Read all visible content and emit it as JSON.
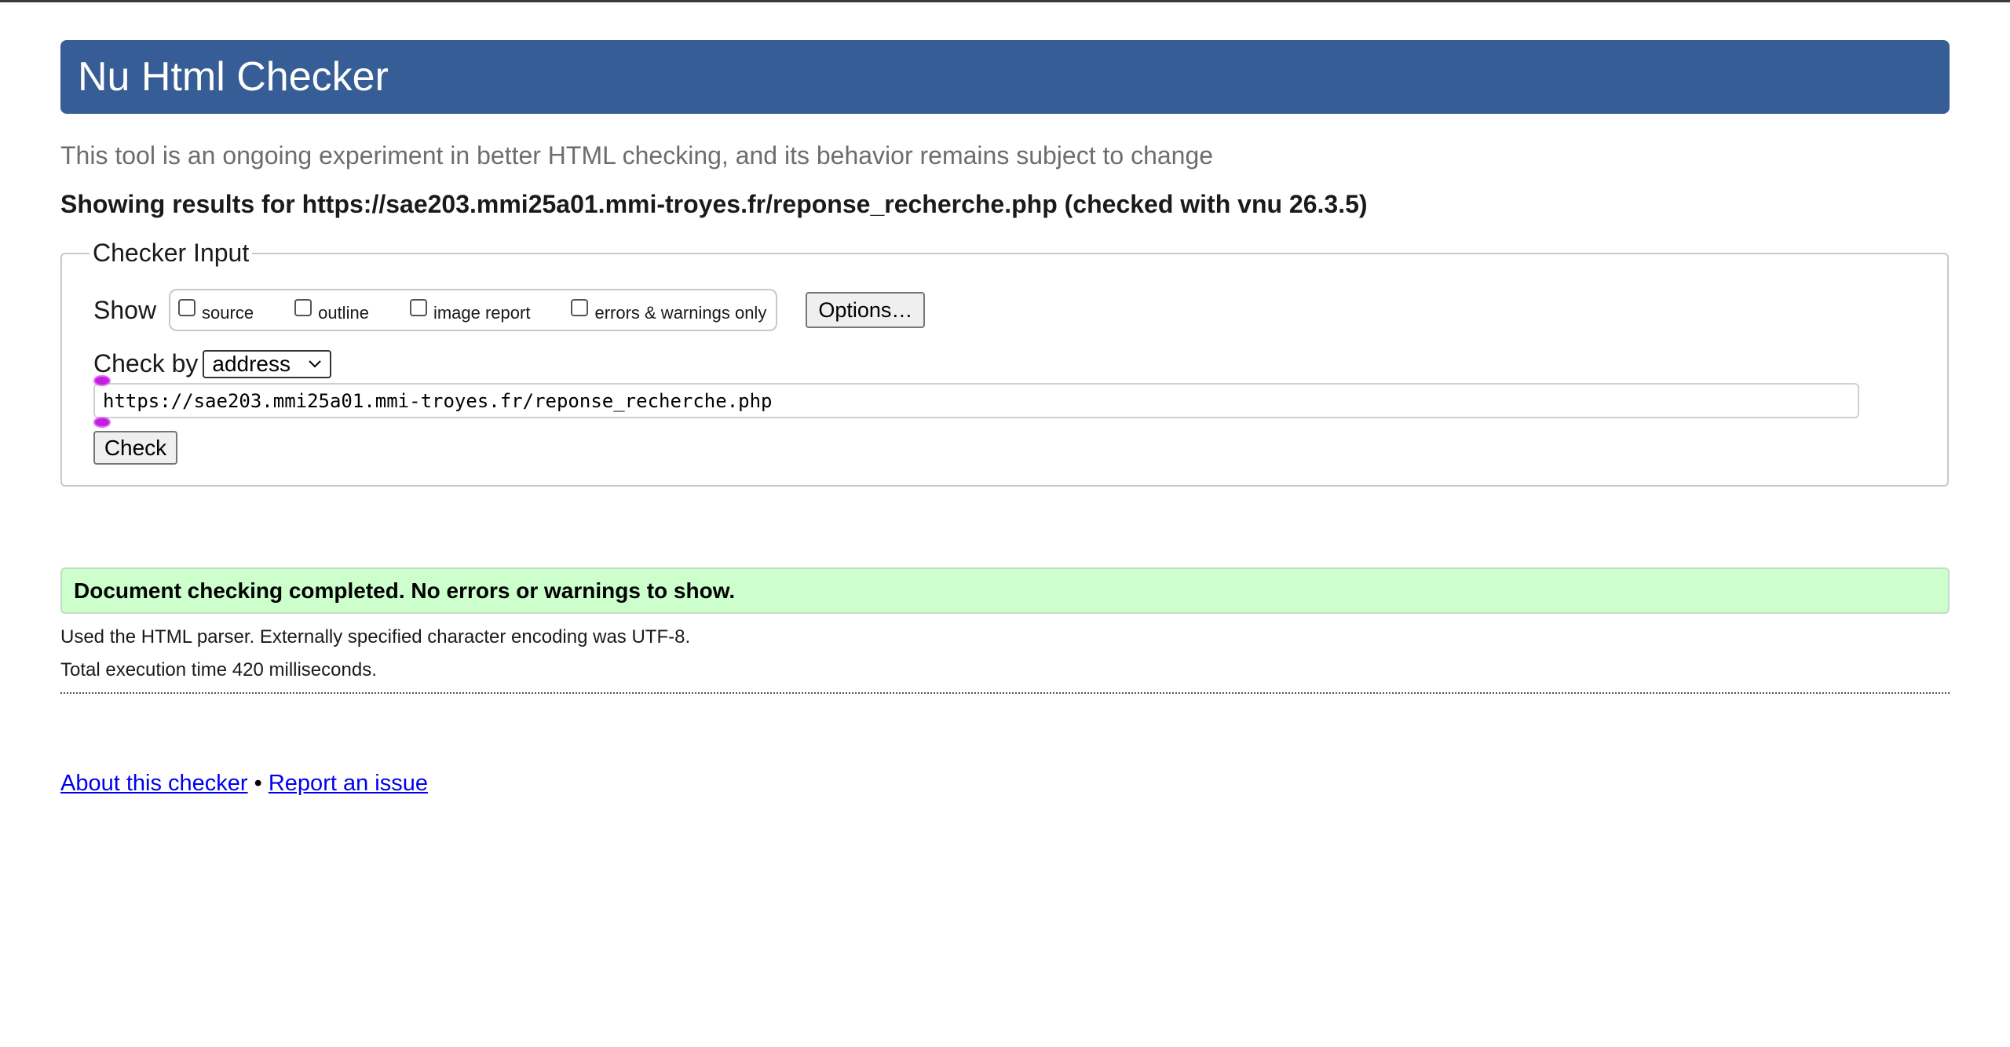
{
  "header": {
    "title": "Nu Html Checker"
  },
  "tagline": "This tool is an ongoing experiment in better HTML checking, and its behavior remains subject to change",
  "results_for": "Showing results for https://sae203.mmi25a01.mmi-troyes.fr/reponse_recherche.php (checked with vnu 26.3.5)",
  "checker_input": {
    "legend": "Checker Input",
    "show_label": "Show",
    "options": [
      {
        "label": "source",
        "checked": false
      },
      {
        "label": "outline",
        "checked": false
      },
      {
        "label": "image report",
        "checked": false
      },
      {
        "label": "errors & warnings only",
        "checked": false
      }
    ],
    "options_button": "Options…",
    "check_by_label": "Check by",
    "check_by_value": "address",
    "url_value": "https://sae203.mmi25a01.mmi-troyes.fr/reponse_recherche.php",
    "check_button": "Check"
  },
  "result": {
    "message": "Document checking completed. No errors or warnings to show.",
    "parser_note": "Used the HTML parser. Externally specified character encoding was UTF-8.",
    "execution_time": "Total execution time 420 milliseconds."
  },
  "footer": {
    "about_link": "About this checker",
    "separator": "•",
    "report_link": "Report an issue"
  },
  "colors": {
    "header_bg": "#365d95",
    "success_bg": "#ccffcc",
    "link": "#0000ee"
  }
}
